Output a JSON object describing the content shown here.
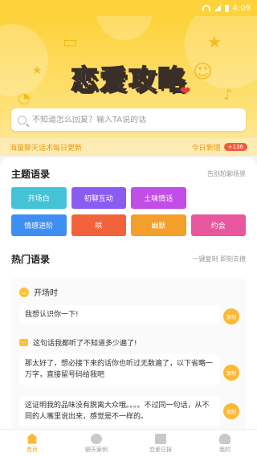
{
  "statusbar": {
    "time": "4:09"
  },
  "hero": {
    "title": "恋爱攻略",
    "search_placeholder": "不知道怎么回复？输入TA说的话"
  },
  "update_bar": {
    "left_text": "海量聊天话术每日更新",
    "right_text": "今日新增",
    "badge": "+136"
  },
  "topics": {
    "title": "主题语录",
    "hint": "告别尬聊场景",
    "tags": [
      {
        "label": "开场白",
        "color": "#44c3d6"
      },
      {
        "label": "初聊互动",
        "color": "#8b5cf2"
      },
      {
        "label": "土味情话",
        "color": "#c24ee7"
      },
      {
        "label": "情感进阶",
        "color": "#3d8ff2"
      },
      {
        "label": "哄",
        "color": "#f2633c"
      },
      {
        "label": "幽默",
        "color": "#f2a02a"
      },
      {
        "label": "约会",
        "color": "#e8579d"
      }
    ]
  },
  "hot": {
    "title": "热门语录",
    "hint": "一键复制 即刻去撩",
    "card_title": "开场时",
    "copy_label": "复制",
    "items": [
      {
        "text": "我想认识你一下!"
      },
      {
        "question": "这句话我都听了不知道多少遍了!"
      },
      {
        "text": "那太好了，想必接下来的话你也听过无数遍了，以下省略一万字，直接留号码给我吧"
      },
      {
        "text": "这证明我的品味没有脱离大众哦。。。。不过同一句话，从不同的人嘴里说出来，感觉是不一样的。"
      }
    ]
  },
  "tabbar": {
    "tabs": [
      {
        "label": "首页",
        "icon": "home-icon"
      },
      {
        "label": "聊天案例",
        "icon": "chat-icon"
      },
      {
        "label": "恋爱日报",
        "icon": "diary-icon"
      },
      {
        "label": "我的",
        "icon": "person-icon"
      }
    ]
  }
}
